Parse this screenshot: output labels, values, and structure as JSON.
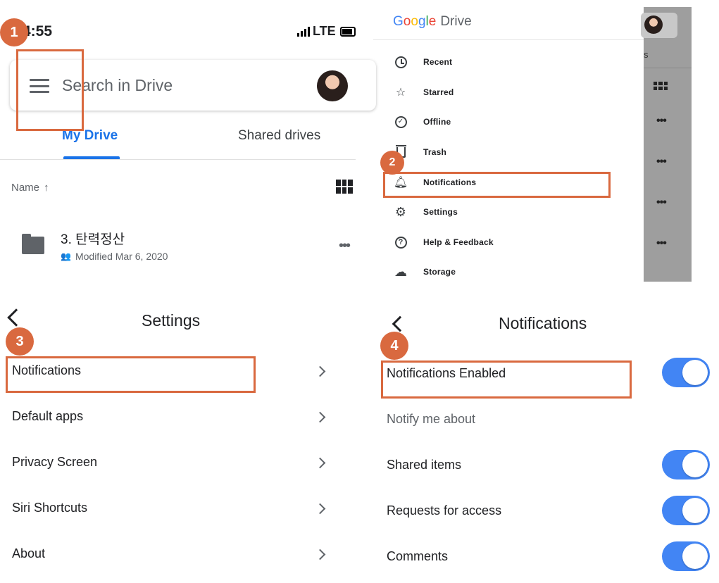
{
  "panel1": {
    "status_time": "4:55",
    "carrier": "LTE",
    "search_placeholder": "Search in Drive",
    "tabs": [
      "My Drive",
      "Shared drives"
    ],
    "sort_label": "Name",
    "file": {
      "name": "3. 탄력정산",
      "modified": "Modified Mar 6, 2020"
    },
    "step": "1"
  },
  "panel2": {
    "logo_google": [
      "G",
      "o",
      "o",
      "g",
      "l",
      "e"
    ],
    "logo_colors": [
      "#4285F4",
      "#EA4335",
      "#FBBC05",
      "#4285F4",
      "#34A853",
      "#EA4335"
    ],
    "logo_drive": "Drive",
    "overlay_s": "s",
    "menu": [
      {
        "label": "Recent",
        "icon": "clock-icon"
      },
      {
        "label": "Starred",
        "icon": "star-icon"
      },
      {
        "label": "Offline",
        "icon": "offline-icon"
      },
      {
        "label": "Trash",
        "icon": "trash-icon"
      },
      {
        "label": "Notifications",
        "icon": "bell-icon"
      },
      {
        "label": "Settings",
        "icon": "gear-icon"
      },
      {
        "label": "Help & Feedback",
        "icon": "help-icon"
      },
      {
        "label": "Storage",
        "icon": "cloud-icon"
      }
    ],
    "step": "2"
  },
  "panel3": {
    "title": "Settings",
    "rows": [
      "Notifications",
      "Default apps",
      "Privacy Screen",
      "Siri Shortcuts",
      "About"
    ],
    "step": "3"
  },
  "panel4": {
    "title": "Notifications",
    "enabled_label": "Notifications Enabled",
    "notify_about": "Notify me about",
    "items": [
      "Shared items",
      "Requests for access",
      "Comments"
    ],
    "step": "4"
  },
  "colors": {
    "accent": "#1a73e8",
    "toggle_on": "#4285f4",
    "highlight": "#d9693f"
  }
}
